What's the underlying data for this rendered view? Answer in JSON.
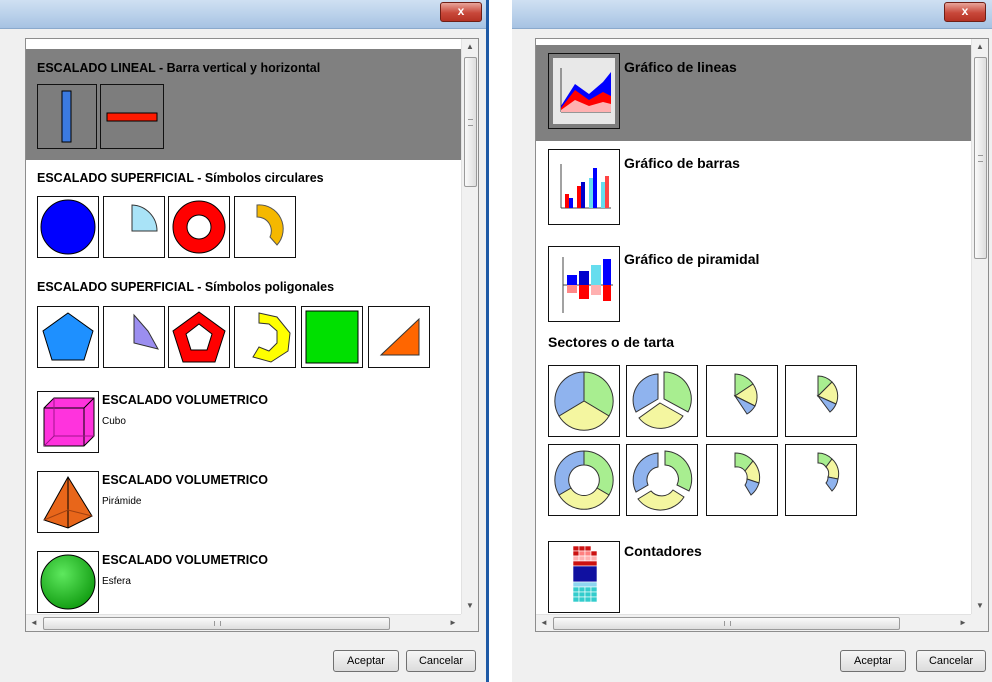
{
  "left_dialog": {
    "close_glyph": "x",
    "sections": {
      "linear": {
        "title": "ESCALADO LINEAL - Barra vertical y horizontal"
      },
      "circular": {
        "title": "ESCALADO SUPERFICIAL - Símbolos circulares"
      },
      "polygonal": {
        "title": "ESCALADO SUPERFICIAL - Símbolos poligonales"
      },
      "cube": {
        "title": "ESCALADO VOLUMETRICO",
        "subtitle": "Cubo"
      },
      "pyramid": {
        "title": "ESCALADO VOLUMETRICO",
        "subtitle": "Pirámide"
      },
      "sphere": {
        "title": "ESCALADO VOLUMETRICO",
        "subtitle": "Esfera"
      }
    },
    "buttons": {
      "ok": "Aceptar",
      "cancel": "Cancelar"
    },
    "scroll": {
      "up": "▲",
      "down": "▼",
      "left": "◄",
      "right": "►"
    }
  },
  "right_dialog": {
    "close_glyph": "x",
    "sections": {
      "lines": {
        "title": "Gráfico de lineas"
      },
      "bars": {
        "title": "Gráfico de barras"
      },
      "pyramid": {
        "title": "Gráfico de piramidal"
      },
      "pie": {
        "title": "Sectores o de tarta"
      },
      "counters": {
        "title": "Contadores"
      }
    },
    "buttons": {
      "ok": "Aceptar",
      "cancel": "Cancelar"
    },
    "scroll": {
      "up": "▲",
      "down": "▼",
      "left": "◄",
      "right": "►"
    }
  },
  "colors": {
    "selection": "#808080",
    "blue": "#0000ff",
    "red": "#ff0000",
    "light_blue": "#a9e3f7",
    "orange": "#f5b800",
    "pentagon_blue": "#1e90ff",
    "violet": "#9b8ef0",
    "yellow": "#ffff00",
    "green": "#00e000",
    "orange_triangle": "#ff6600",
    "magenta": "#ff33dd",
    "pyramid_orange": "#e8661a",
    "sphere_green": "#1fc41f",
    "pie_green": "#a8ee90",
    "pie_yellow": "#f4f6a0",
    "pie_blue": "#8fb3ee"
  }
}
